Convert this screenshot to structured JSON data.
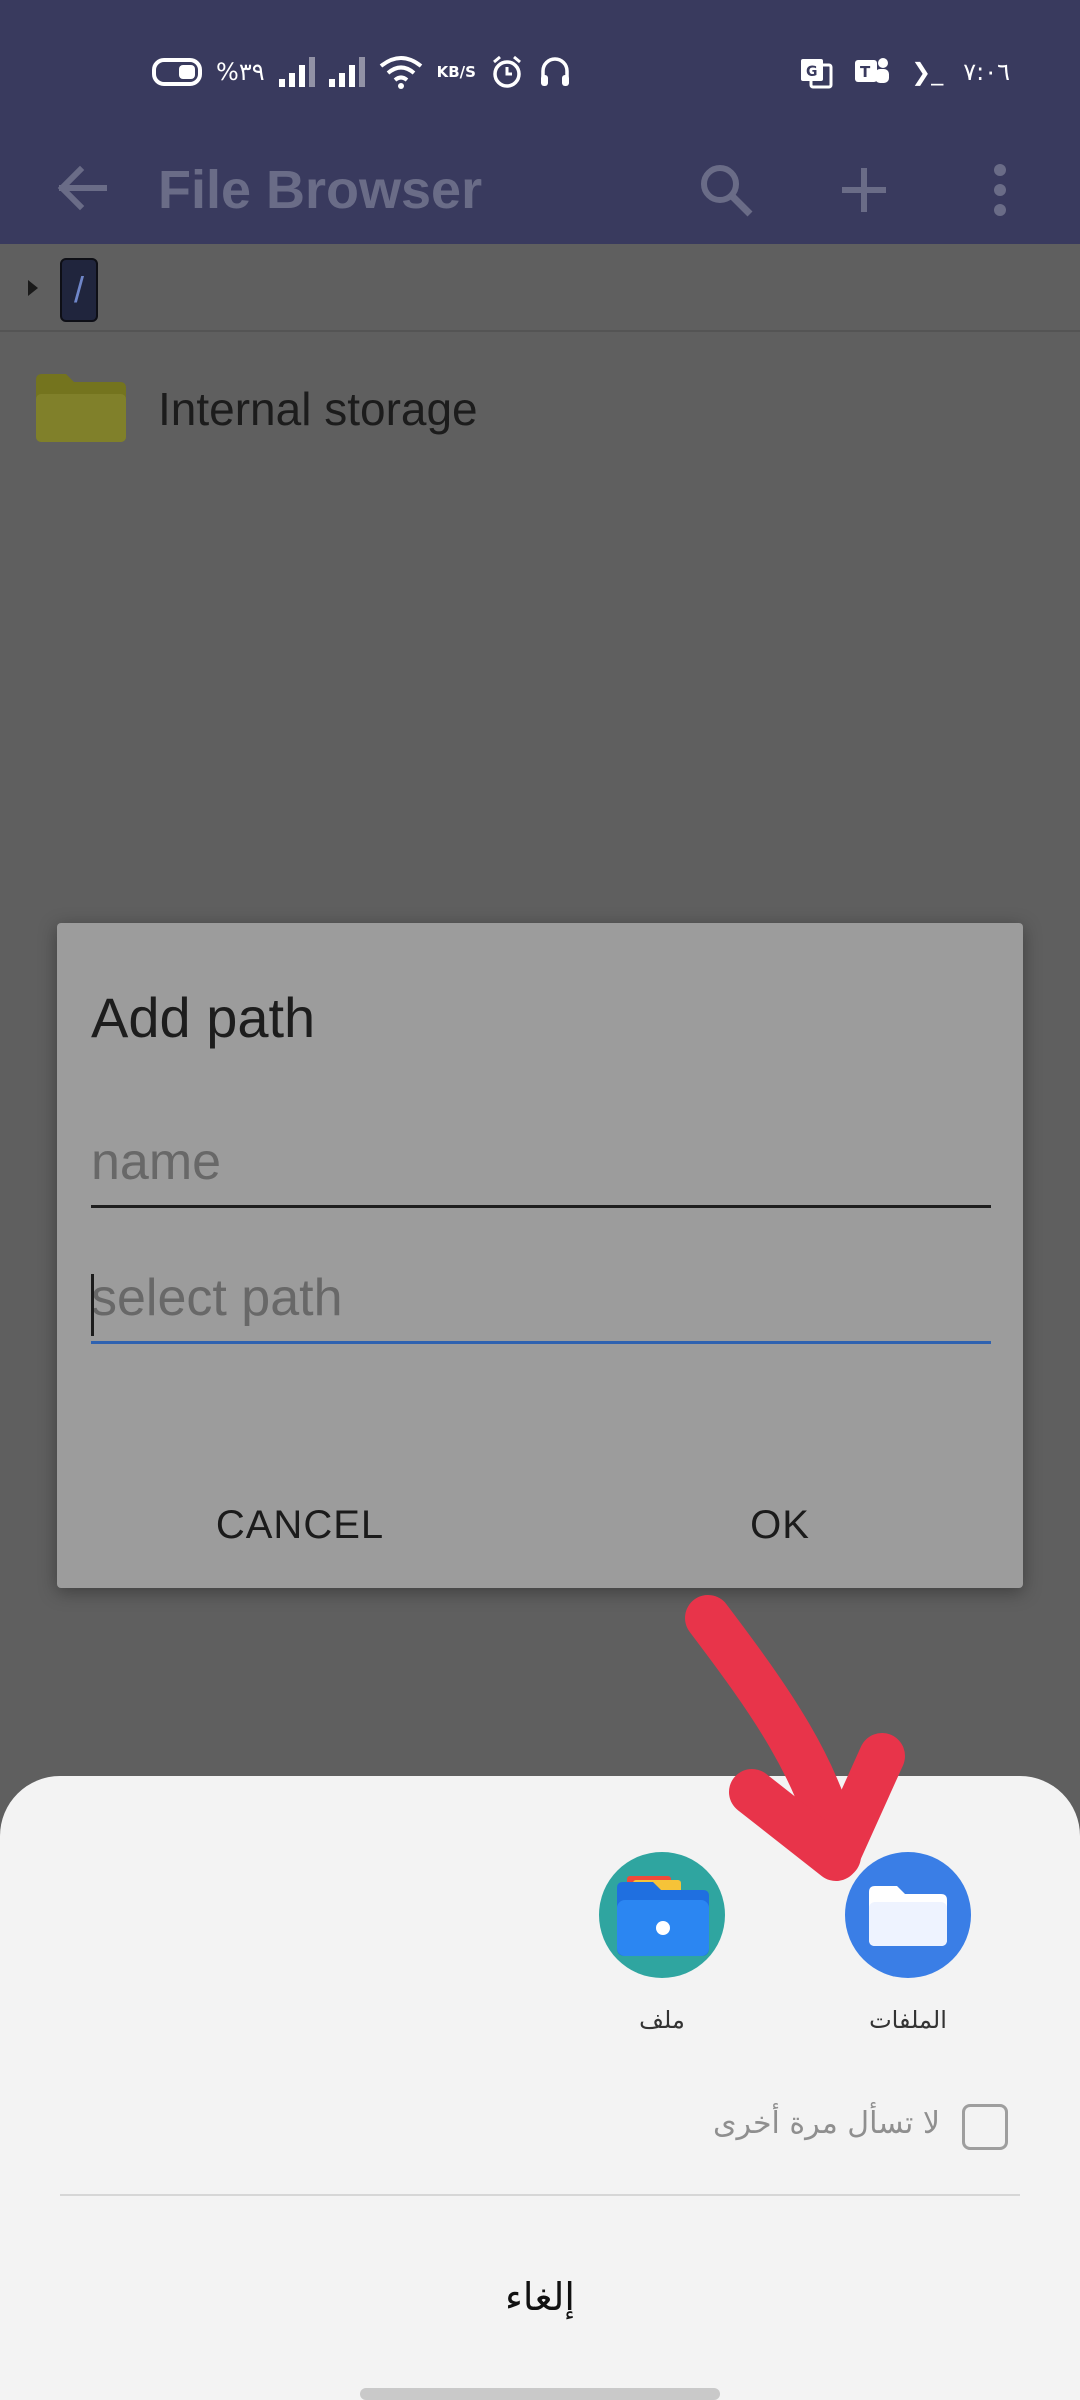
{
  "status_bar": {
    "battery_percent": "%٣٩",
    "data_speed": "KB/S",
    "time": "٧:٠٦",
    "terminal_glyph": "❯_"
  },
  "app_bar": {
    "title": "File Browser",
    "icons": [
      "back-arrow-icon",
      "search-icon",
      "add-icon",
      "more-vert-icon"
    ]
  },
  "breadcrumb": {
    "root": "/"
  },
  "files": [
    {
      "name": "Internal storage",
      "icon": "folder-icon"
    }
  ],
  "dialog": {
    "title": "Add path",
    "name_field": {
      "value": "",
      "placeholder": "name"
    },
    "path_field": {
      "value": "",
      "placeholder": "select path"
    },
    "cancel_label": "CANCEL",
    "ok_label": "OK"
  },
  "chooser": {
    "apps": [
      {
        "label": "الملفات",
        "icon": "files-app-icon"
      },
      {
        "label": "ملف",
        "icon": "file-manager-app-icon"
      }
    ],
    "remember_label": "لا تسأل مرة أخرى",
    "remember_checked": false,
    "cancel_label": "إلغاء"
  },
  "colors": {
    "status_bar": "#393a5e",
    "dim_overlay": "#5f5f5f",
    "dialog_bg": "#9c9c9c",
    "sheet_bg": "#f3f3f3",
    "accent_blue": "#2f62b0",
    "annotation_red": "#e8344a"
  }
}
